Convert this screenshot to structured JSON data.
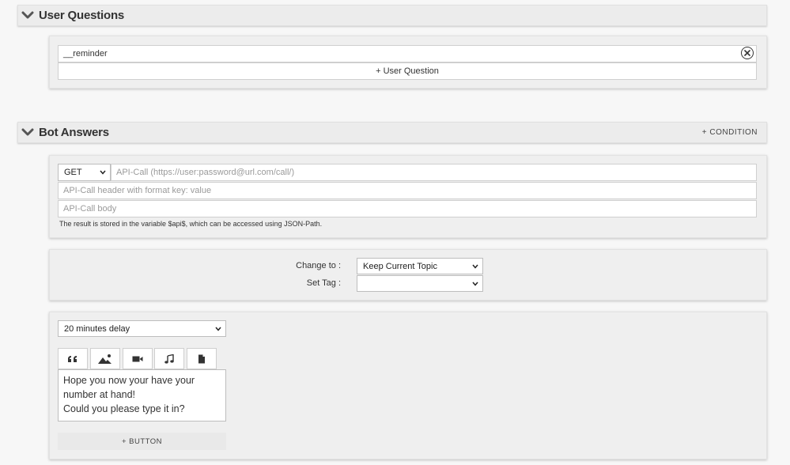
{
  "user_questions": {
    "title": "User Questions",
    "question_value": "__reminder",
    "add_label": "+ User Question"
  },
  "bot_answers": {
    "title": "Bot Answers",
    "condition_label": "+ CONDITION",
    "api": {
      "method": "GET",
      "url_placeholder": "API-Call (https://user:password@url.com/call/)",
      "header_placeholder": "API-Call header with format key: value",
      "body_placeholder": "API-Call body",
      "note": "The result is stored in the variable $api$, which can be accessed using JSON-Path."
    },
    "topic": {
      "change_to_label": "Change to :",
      "change_to_value": "Keep Current Topic",
      "set_tag_label": "Set Tag :",
      "set_tag_value": ""
    },
    "message": {
      "delay": "20 minutes delay",
      "media_tabs": [
        "quote-icon",
        "image-icon",
        "video-icon",
        "music-icon",
        "file-icon"
      ],
      "text_lines": [
        "Hope you now your have your",
        "number at hand!",
        "Could you please type it in?"
      ],
      "add_button_label": "+ BUTTON"
    }
  }
}
